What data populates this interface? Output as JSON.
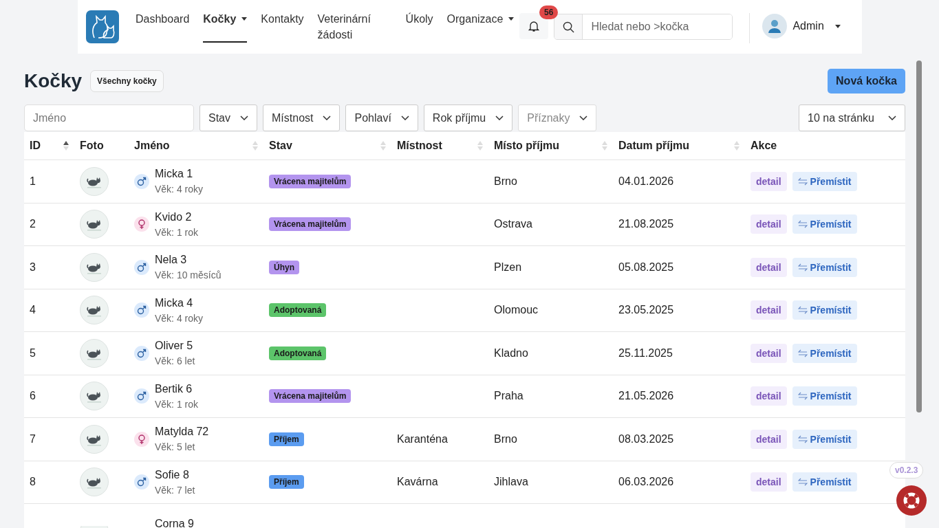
{
  "nav": {
    "items": [
      {
        "label": "Dashboard",
        "selected": false,
        "dropdown": false
      },
      {
        "label": "Kočky",
        "selected": true,
        "dropdown": true
      },
      {
        "label": "Kontakty",
        "selected": false,
        "dropdown": false
      },
      {
        "label": "Veterinární žádosti",
        "selected": false,
        "dropdown": false
      },
      {
        "label": "Úkoly",
        "selected": false,
        "dropdown": false
      },
      {
        "label": "Organizace",
        "selected": false,
        "dropdown": true
      }
    ],
    "notifications": "56",
    "search": {
      "placeholder": "Hledat nebo >kočka"
    },
    "user": "Admin"
  },
  "page": {
    "title": "Kočky",
    "scope": "Všechny kočky",
    "new_button": "Nová kočka"
  },
  "filters": {
    "name": {
      "placeholder": "Jméno"
    },
    "dropdowns": [
      {
        "label": "Stav",
        "disabled": false
      },
      {
        "label": "Místnost",
        "disabled": false
      },
      {
        "label": "Pohlaví",
        "disabled": false
      },
      {
        "label": "Rok příjmu",
        "disabled": false
      },
      {
        "label": "Příznaky",
        "disabled": true
      }
    ],
    "page_size": "10 na stránku"
  },
  "table": {
    "columns": [
      {
        "label": "ID",
        "sortable": true,
        "sorted": true
      },
      {
        "label": "Foto",
        "sortable": false
      },
      {
        "label": "Jméno",
        "sortable": true,
        "sorted": false
      },
      {
        "label": "Stav",
        "sortable": true,
        "sorted": false
      },
      {
        "label": "Místnost",
        "sortable": true,
        "sorted": false
      },
      {
        "label": "Místo příjmu",
        "sortable": true,
        "sorted": false
      },
      {
        "label": "Datum příjmu",
        "sortable": true,
        "sorted": false
      },
      {
        "label": "Akce",
        "sortable": false
      }
    ],
    "rows": [
      {
        "id": "1",
        "name": "Micka 1",
        "kind": "male",
        "age": "Věk: 4 roky",
        "status": "Vrácena majitelům",
        "color": "#b394ee",
        "origin": "Brno",
        "date": "04.01.2026",
        "detail": "detail",
        "move": "Přemístit"
      },
      {
        "id": "2",
        "name": "Kvido 2",
        "kind": "female",
        "age": "Věk: 1 rok",
        "status": "Vrácena majitelům",
        "color": "#b394ee",
        "origin": "Ostrava",
        "date": "21.08.2025",
        "detail": "detail",
        "move": "Přemístit"
      },
      {
        "id": "3",
        "name": "Nela 3",
        "kind": "male",
        "age": "Věk: 10 měsíců",
        "status": "Úhyn",
        "color": "#b394ee",
        "origin": "Plzen",
        "date": "05.08.2025",
        "detail": "detail",
        "move": "Přemístit"
      },
      {
        "id": "4",
        "name": "Micka 4",
        "kind": "male",
        "age": "Věk: 4 roky",
        "status": "Adoptovaná",
        "color": "#5cc46a",
        "origin": "Olomouc",
        "date": "23.05.2025",
        "detail": "detail",
        "move": "Přemístit"
      },
      {
        "id": "5",
        "name": "Oliver 5",
        "kind": "male",
        "age": "Věk: 6 let",
        "status": "Adoptovaná",
        "color": "#5cc46a",
        "origin": "Kladno",
        "date": "25.11.2025",
        "detail": "detail",
        "move": "Přemístit"
      },
      {
        "id": "6",
        "name": "Bertik 6",
        "kind": "male",
        "age": "Věk: 1 rok",
        "status": "Vrácena majitelům",
        "color": "#b394ee",
        "origin": "Praha",
        "date": "21.05.2026",
        "detail": "detail",
        "move": "Přemístit"
      },
      {
        "id": "7",
        "name": "Matylda 72",
        "kind": "female",
        "age": "Věk: 5 let",
        "status": "Příjem",
        "color": "#5b9cf0",
        "room": "Karanténa",
        "origin": "Brno",
        "date": "08.03.2025",
        "detail": "detail",
        "move": "Přemístit"
      },
      {
        "id": "8",
        "name": "Sofie 8",
        "kind": "male",
        "age": "Věk: 7 let",
        "status": "Příjem",
        "color": "#5b9cf0",
        "room": "Kavárna",
        "origin": "Jihlava",
        "date": "06.03.2026",
        "detail": "detail",
        "move": "Přemístit"
      },
      {
        "name": "Corna 9"
      }
    ]
  },
  "version": "v0.2.3"
}
